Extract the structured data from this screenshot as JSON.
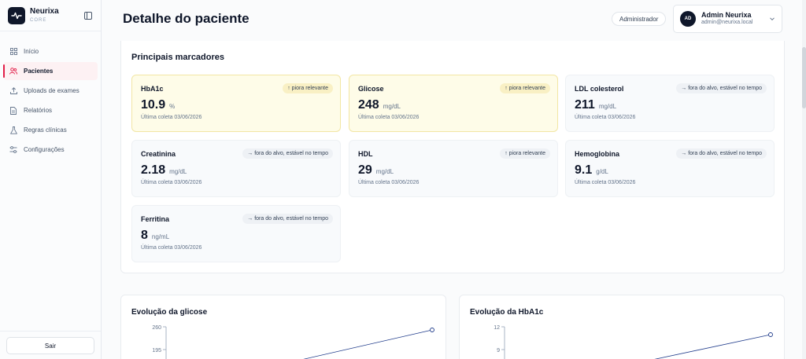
{
  "brand": {
    "name": "Neurixa",
    "sub": "CORE"
  },
  "sidebar": {
    "items": [
      {
        "label": "Início",
        "icon": "grid-icon"
      },
      {
        "label": "Pacientes",
        "icon": "users-icon",
        "active": true
      },
      {
        "label": "Uploads de exames",
        "icon": "upload-icon"
      },
      {
        "label": "Relatórios",
        "icon": "file-icon"
      },
      {
        "label": "Regras clínicas",
        "icon": "flask-icon"
      },
      {
        "label": "Configurações",
        "icon": "sliders-icon"
      }
    ],
    "logout_label": "Sair"
  },
  "header": {
    "title": "Detalhe do paciente",
    "role": "Administrador",
    "user": {
      "initials": "AD",
      "name": "Admin Neurixa",
      "email": "admin@neurixa.local"
    }
  },
  "markers": {
    "title": "Principais marcadores",
    "items": [
      {
        "name": "HbA1c",
        "value": "10.9",
        "unit": "%",
        "tag": "↑ piora relevante",
        "date": "Última coleta 03/06/2026",
        "status": "warn"
      },
      {
        "name": "Glicose",
        "value": "248",
        "unit": "mg/dL",
        "tag": "↑ piora relevante",
        "date": "Última coleta 03/06/2026",
        "status": "warn"
      },
      {
        "name": "LDL colesterol",
        "value": "211",
        "unit": "mg/dL",
        "tag": "→ fora do alvo, estável no tempo",
        "date": "Última coleta 03/06/2026",
        "status": "neutral"
      },
      {
        "name": "Creatinina",
        "value": "2.18",
        "unit": "mg/dL",
        "tag": "→ fora do alvo, estável no tempo",
        "date": "Última coleta 03/06/2026",
        "status": "neutral"
      },
      {
        "name": "HDL",
        "value": "29",
        "unit": "mg/dL",
        "tag": "↑ piora relevante",
        "date": "Última coleta 03/06/2026",
        "status": "neutral"
      },
      {
        "name": "Hemoglobina",
        "value": "9.1",
        "unit": "g/dL",
        "tag": "→ fora do alvo, estável no tempo",
        "date": "Última coleta 03/06/2026",
        "status": "neutral"
      },
      {
        "name": "Ferritina",
        "value": "8",
        "unit": "ng/mL",
        "tag": "→ fora do alvo, estável no tempo",
        "date": "Última coleta 03/06/2026",
        "status": "neutral"
      }
    ]
  },
  "charts": [
    {
      "title": "Evolução da glicose",
      "ticks": [
        "260",
        "195"
      ],
      "chart_data": {
        "type": "line",
        "title": "Evolução da glicose",
        "y_ticks": [
          260,
          195
        ],
        "points_visible": [
          {
            "y": 248
          }
        ]
      }
    },
    {
      "title": "Evolução da HbA1c",
      "ticks": [
        "12",
        "9"
      ],
      "chart_data": {
        "type": "line",
        "title": "Evolução da HbA1c",
        "y_ticks": [
          12,
          9
        ],
        "points_visible": [
          {
            "y": 10.9
          }
        ]
      }
    }
  ],
  "colors": {
    "accent": "#e11d48",
    "warn_bg": "#fefce8",
    "line": "#1e3a8a"
  }
}
